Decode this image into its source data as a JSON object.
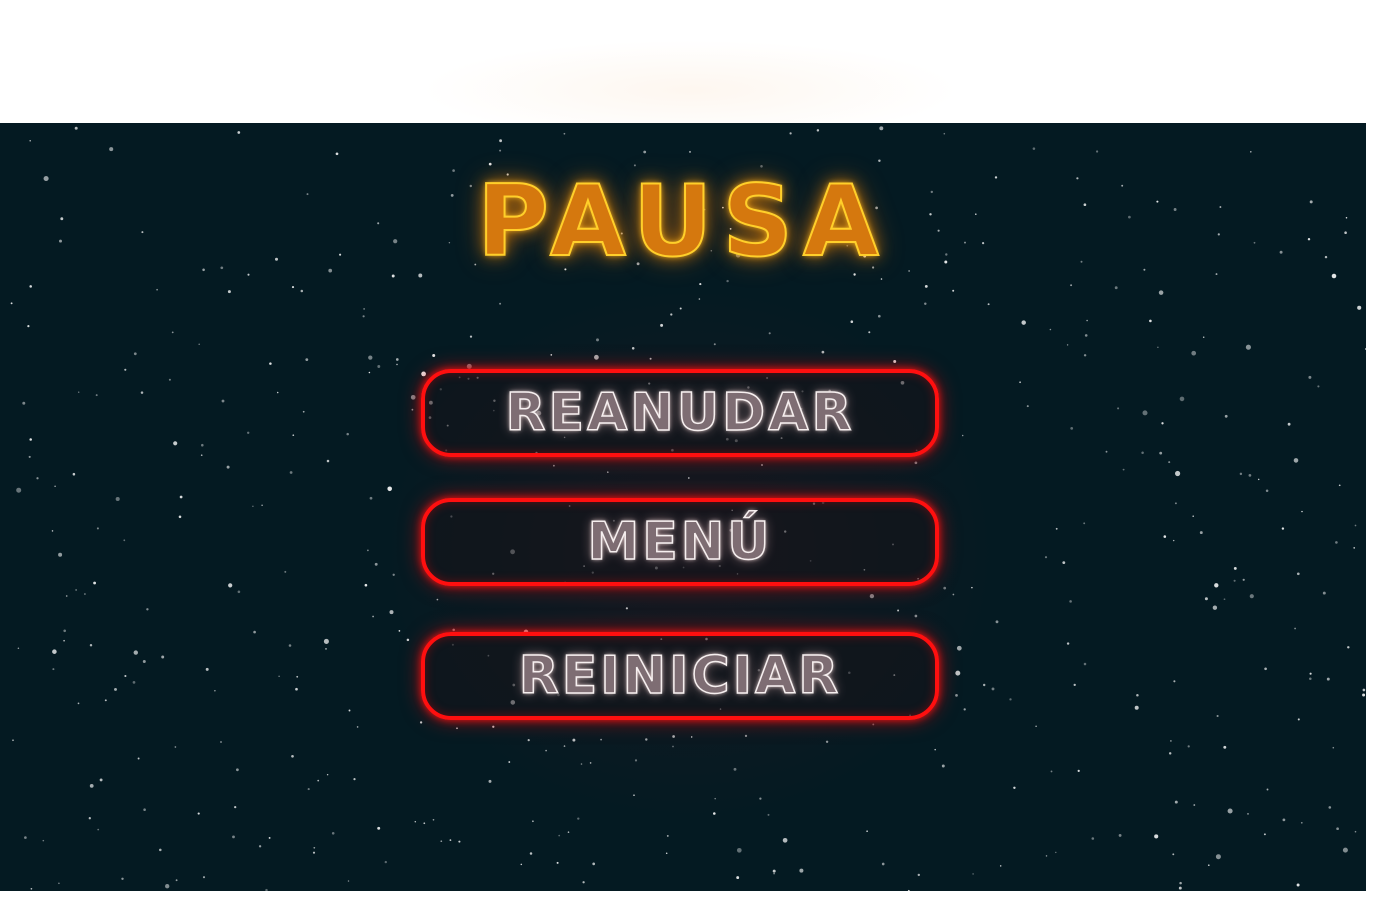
{
  "pause_menu": {
    "title": "PAUSA",
    "buttons": {
      "resume": "REANUDAR",
      "menu": "MENÚ",
      "restart": "REINICIAR"
    }
  },
  "colors": {
    "background": "#041a22",
    "title_fill": "#d5780e",
    "title_outline": "#ffcf2a",
    "button_border": "#ff0f0f",
    "button_text": "#f6efef"
  }
}
